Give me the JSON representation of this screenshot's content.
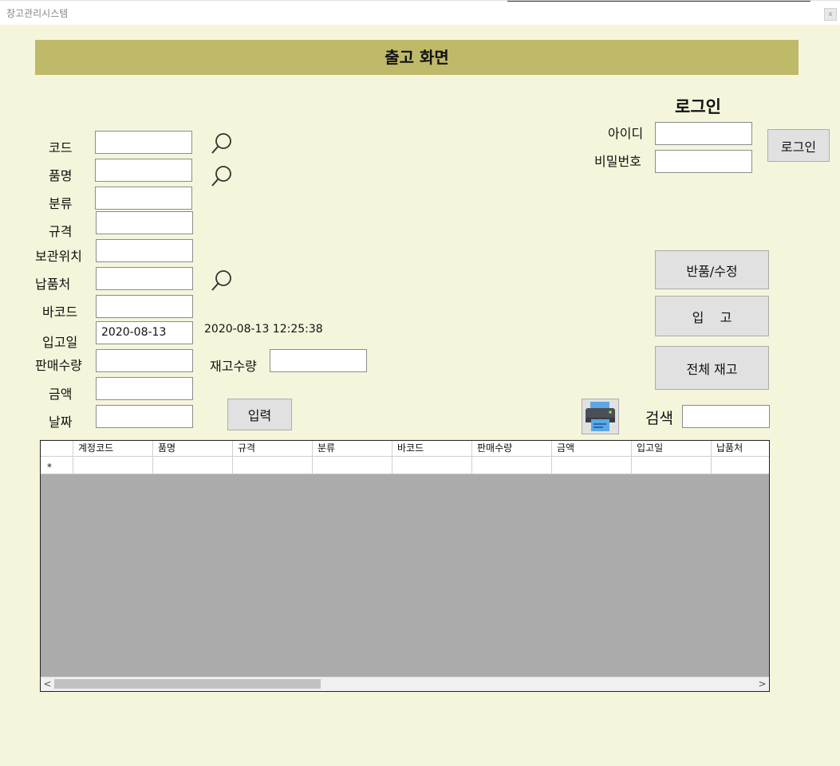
{
  "window": {
    "title": "창고관리시스템",
    "close_glyph": "x"
  },
  "banner": {
    "title": "출고 화면"
  },
  "login": {
    "title": "로그인",
    "id_label": "아이디",
    "pw_label": "비밀번호",
    "id_value": "",
    "pw_value": "",
    "button": "로그인"
  },
  "form": {
    "code_label": "코드",
    "name_label": "품명",
    "category_label": "분류",
    "spec_label": "규격",
    "location_label": "보관위치",
    "supplier_label": "납품처",
    "barcode_label": "바코드",
    "indate_label": "입고일",
    "indate_value": "2020-08-13",
    "datetime_text": "2020-08-13 12:25:38",
    "sales_qty_label": "판매수량",
    "stock_qty_label": "재고수량",
    "amount_label": "금액",
    "date_label": "날짜",
    "code_value": "",
    "name_value": "",
    "category_value": "",
    "spec_value": "",
    "location_value": "",
    "supplier_value": "",
    "barcode_value": "",
    "sales_qty_value": "",
    "stock_qty_value": "",
    "amount_value": "",
    "date_value": "",
    "input_button": "입력"
  },
  "actions": {
    "return_edit": "반품/수정",
    "inbound": "입    고",
    "total_stock": "전체 재고",
    "search_label": "검색",
    "search_value": ""
  },
  "grid": {
    "columns": [
      "계정코드",
      "품명",
      "규격",
      "분류",
      "바코드",
      "판매수량",
      "금액",
      "입고일",
      "납품처"
    ],
    "new_row_marker": "*",
    "scroll_left": "<",
    "scroll_right": ">"
  },
  "colors": {
    "background": "#f5f5dc",
    "banner": "#bfb96a",
    "grid_empty": "#ababab"
  }
}
